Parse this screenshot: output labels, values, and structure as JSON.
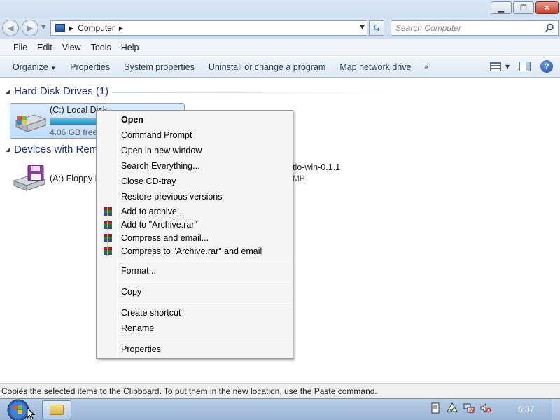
{
  "window": {
    "minimize_glyph": "▁",
    "maximize_glyph": "❐",
    "close_glyph": "✕"
  },
  "address": {
    "location": "Computer",
    "search_placeholder": "Search Computer"
  },
  "menubar": {
    "items": [
      "File",
      "Edit",
      "View",
      "Tools",
      "Help"
    ]
  },
  "commandbar": {
    "organize": "Organize",
    "properties": "Properties",
    "system_properties": "System properties",
    "uninstall": "Uninstall or change a program",
    "map_network_drive": "Map network drive",
    "more": "»"
  },
  "content": {
    "hard_disk_group": "Hard Disk Drives (1)",
    "removable_group": "Devices with Rem",
    "local_disk": {
      "name": "(C:) Local Disk",
      "free_text": "4.06 GB free",
      "used_fraction": 0.85
    },
    "floppy_label": "(A:) Floppy D",
    "other_device_label": "tio-win-0.1.1",
    "other_device_sub": "MB"
  },
  "context_menu": {
    "items": [
      {
        "label": "Open",
        "bold": true,
        "icon": ""
      },
      {
        "label": "Command Prompt",
        "icon": ""
      },
      {
        "label": "Open in new window",
        "icon": ""
      },
      {
        "label": "Search Everything...",
        "icon": ""
      },
      {
        "label": "Close CD-tray",
        "icon": ""
      },
      {
        "label": "Restore previous versions",
        "icon": ""
      },
      {
        "label": "Add to archive...",
        "icon": "winrar-icon"
      },
      {
        "label": "Add to \"Archive.rar\"",
        "icon": "winrar-icon"
      },
      {
        "label": "Compress and email...",
        "icon": "winrar-icon"
      },
      {
        "label": "Compress to \"Archive.rar\" and email",
        "icon": "winrar-icon"
      },
      {
        "label": "Format...",
        "icon": ""
      },
      {
        "label": "Copy",
        "icon": ""
      },
      {
        "label": "Create shortcut",
        "icon": ""
      },
      {
        "label": "Rename",
        "icon": ""
      },
      {
        "label": "Properties",
        "icon": ""
      }
    ]
  },
  "statusbar": {
    "text": "Copies the selected items to the Clipboard. To put them in the new location, use the Paste command."
  },
  "taskbar": {
    "clock": "6:37"
  },
  "colors": {
    "group_title": "#1e3287",
    "selection": "#c1dcfb",
    "drive_bar": "#1d8fc4"
  }
}
